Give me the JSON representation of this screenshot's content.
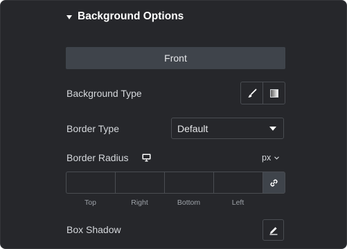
{
  "section": {
    "title": "Background Options"
  },
  "tab": {
    "label": "Front"
  },
  "background_type": {
    "label": "Background Type",
    "options": [
      "classic-brush-icon",
      "gradient-icon"
    ]
  },
  "border_type": {
    "label": "Border Type",
    "value": "Default"
  },
  "border_radius": {
    "label": "Border Radius",
    "unit": "px",
    "sides": [
      "Top",
      "Right",
      "Bottom",
      "Left"
    ],
    "values": [
      "",
      "",
      "",
      ""
    ]
  },
  "box_shadow": {
    "label": "Box Shadow"
  },
  "colors": {
    "panel_bg": "#26272b",
    "tab_bg": "#3f444b",
    "border": "#4a4d52",
    "text": "#d5d8dc",
    "muted": "#9da2a8"
  }
}
